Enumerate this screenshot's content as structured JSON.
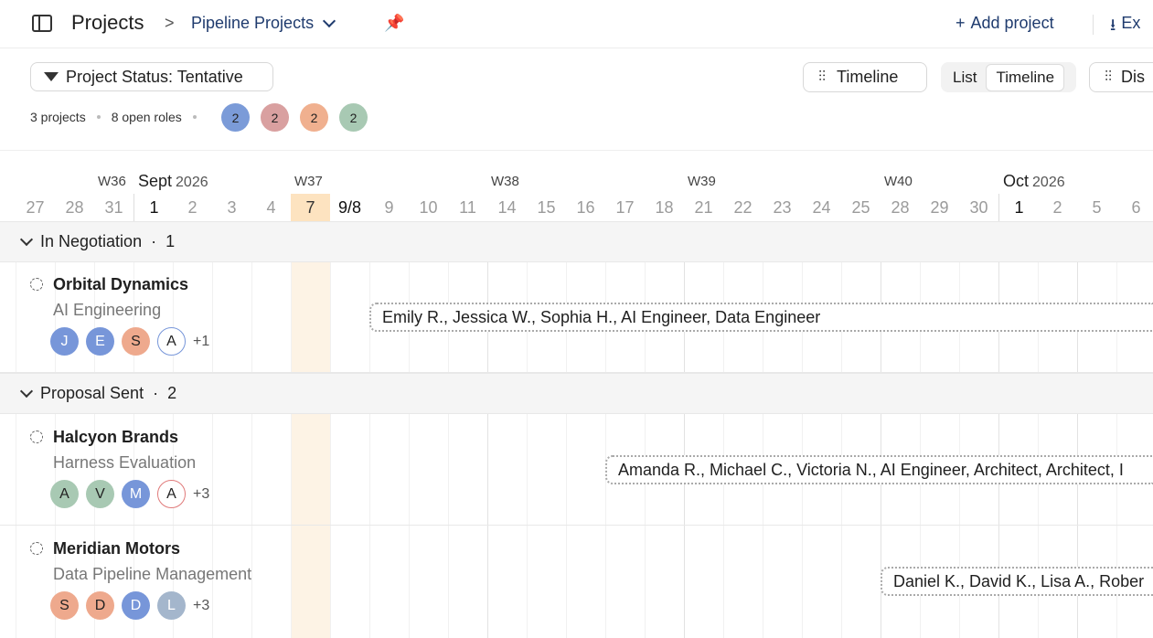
{
  "breadcrumb": {
    "root": "Projects",
    "separator": ">",
    "current": "Pipeline Projects"
  },
  "header_actions": {
    "add_project": "Add project",
    "export": "Ex"
  },
  "filter": {
    "label": "Project Status: Tentative"
  },
  "stats": {
    "projects": "3 projects",
    "open_roles": "8 open roles"
  },
  "role_badges": [
    {
      "count": "2",
      "color": "#7b9bd8"
    },
    {
      "count": "2",
      "color": "#d9a0a0"
    },
    {
      "count": "2",
      "color": "#f0b08f"
    },
    {
      "count": "2",
      "color": "#a8c9b3"
    }
  ],
  "toolbar": {
    "timeline_settings": "Timeline",
    "view_list": "List",
    "view_timeline": "Timeline",
    "display": "Dis"
  },
  "calendar": {
    "weeks": [
      "W36",
      "W37",
      "W38",
      "W39",
      "W40"
    ],
    "months": [
      {
        "name": "Sept",
        "year": "2026"
      },
      {
        "name": "Oct",
        "year": "2026"
      }
    ],
    "days": [
      "6",
      "27",
      "28",
      "31",
      "1",
      "2",
      "3",
      "4",
      "7",
      "9/8",
      "9",
      "10",
      "11",
      "14",
      "15",
      "16",
      "17",
      "18",
      "21",
      "22",
      "23",
      "24",
      "25",
      "28",
      "29",
      "30",
      "1",
      "2",
      "5",
      "6"
    ],
    "today": "7"
  },
  "groups": [
    {
      "name": "In Negotiation",
      "count": "1"
    },
    {
      "name": "Proposal Sent",
      "count": "2"
    }
  ],
  "projects": [
    {
      "name": "Orbital Dynamics",
      "subtitle": "AI Engineering",
      "avatars": [
        "J",
        "E",
        "S",
        "A"
      ],
      "more": "+1",
      "assignments": "Emily R., Jessica W., Sophia H., AI Engineer, Data Engineer"
    },
    {
      "name": "Halcyon Brands",
      "subtitle": "Harness Evaluation",
      "avatars": [
        "A",
        "V",
        "M",
        "A"
      ],
      "more": "+3",
      "assignments": "Amanda R., Michael C., Victoria N., AI Engineer, Architect, Architect, I"
    },
    {
      "name": "Meridian Motors",
      "subtitle": "Data Pipeline Management",
      "avatars": [
        "S",
        "D",
        "D",
        "L"
      ],
      "more": "+3",
      "assignments": "Daniel K., David K., Lisa A., Rober"
    }
  ]
}
